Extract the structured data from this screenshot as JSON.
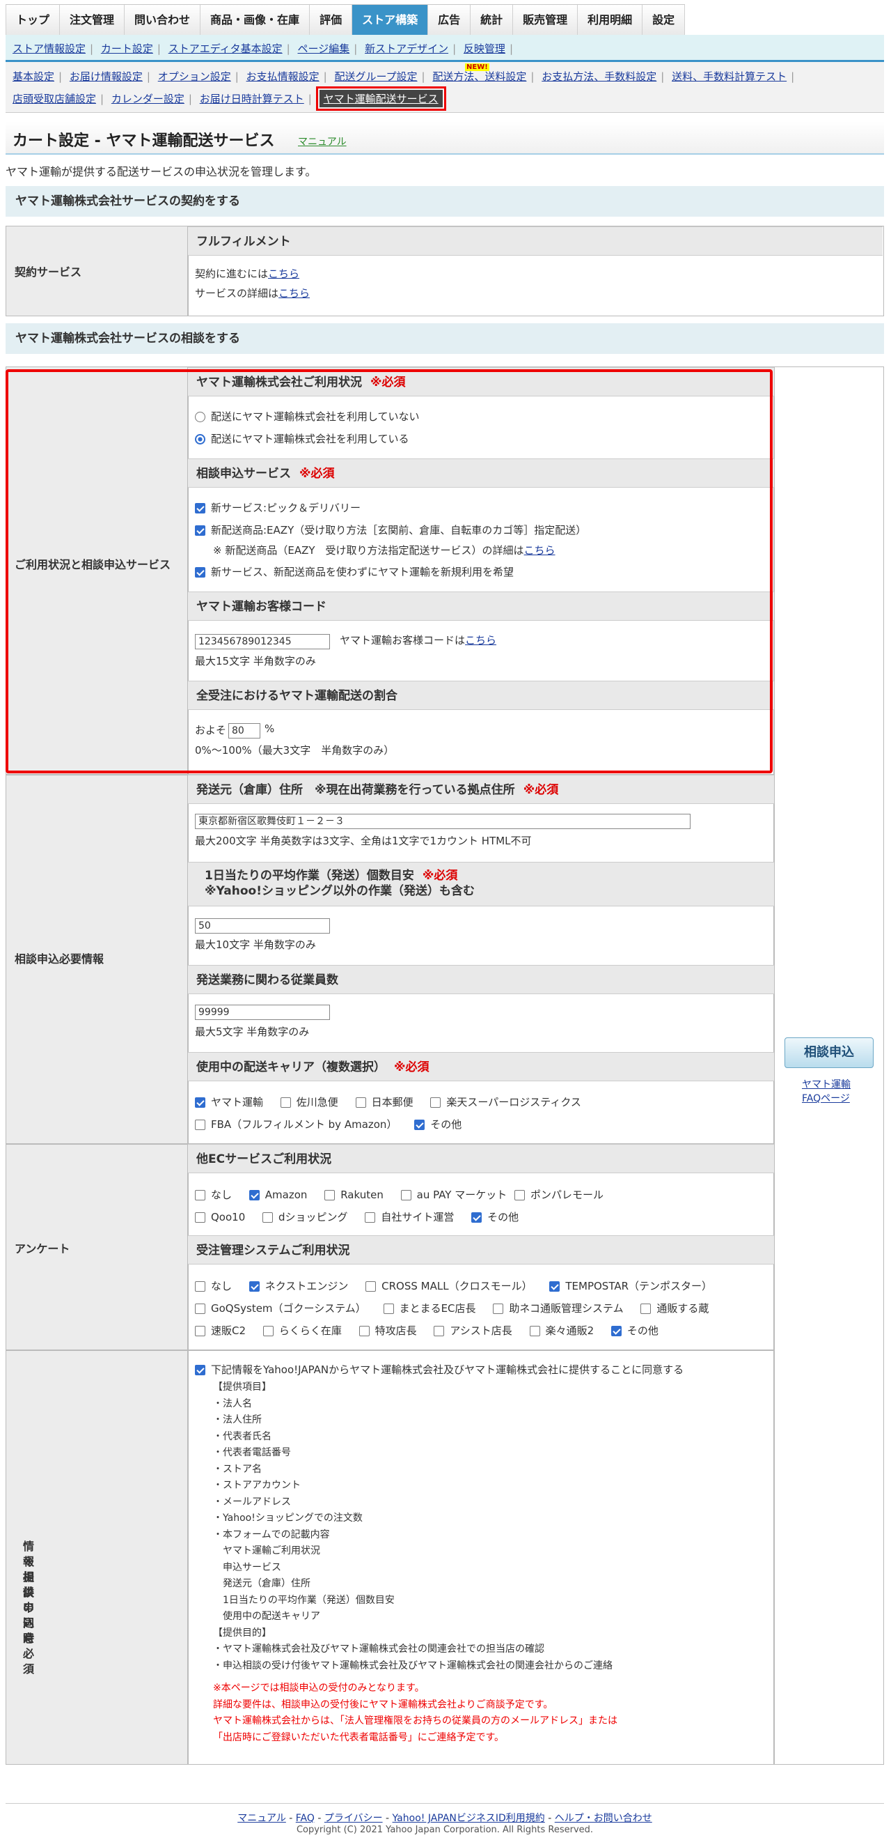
{
  "nav": [
    "トップ",
    "注文管理",
    "問い合わせ",
    "商品・画像・在庫",
    "評価",
    "ストア構築",
    "広告",
    "統計",
    "販売管理",
    "利用明細",
    "設定"
  ],
  "subnav": [
    "ストア情報設定",
    "カート設定",
    "ストアエディタ基本設定",
    "ページ編集",
    "新ストアデザイン",
    "反映管理"
  ],
  "menu_row1": [
    "基本設定",
    "お届け情報設定",
    "オプション設定",
    "お支払情報設定",
    "配送グループ設定",
    "配送方法、送料設定",
    "お支払方法、手数料設定",
    "送料、手数料計算テスト"
  ],
  "menu_row2": [
    "店頭受取店舗設定",
    "カレンダー設定",
    "お届け日時計算テスト"
  ],
  "menu_active": "ヤマト運輸配送サービス",
  "new_badge": "NEW!",
  "page_title": "カート設定 - ヤマト運輸配送サービス",
  "manual_link": "マニュアル",
  "description": "ヤマト運輸が提供する配送サービスの申込状況を管理します。",
  "section1": "ヤマト運輸株式会社サービスの契約をする",
  "contract": {
    "label": "契約サービス",
    "head": "フルフィルメント",
    "line1_pre": "契約に進むには",
    "line2_pre": "サービスの詳細は",
    "link": "こちら"
  },
  "section2": "ヤマト運輸株式会社サービスの相談をする",
  "usage": {
    "label": "ご利用状況と相談申込サービス",
    "status_head": "ヤマト運輸株式会社ご利用状況",
    "req": "※必須",
    "radio1": "配送にヤマト運輸株式会社を利用していない",
    "radio2": "配送にヤマト運輸株式会社を利用している",
    "service_head": "相談申込サービス",
    "svc1": "新サービス:ピック＆デリバリー",
    "svc2": "新配送商品:EAZY（受け取り方法［玄関前、倉庫、自転車のカゴ等］指定配送）",
    "svc2_note": "※ 新配送商品（EAZY　受け取り方法指定配送サービス）の詳細は",
    "svc3": "新サービス、新配送商品を使わずにヤマト運輸を新規利用を希望",
    "code_head": "ヤマト運輸お客様コード",
    "code_value": "123456789012345",
    "code_note": "ヤマト運輸お客様コードは",
    "code_hint": "最大15文字 半角数字のみ",
    "ratio_head": "全受注におけるヤマト運輸配送の割合",
    "ratio_pre": "およそ",
    "ratio_value": "80",
    "ratio_unit": "%",
    "ratio_hint": "0%～100%（最大3文字　半角数字のみ）",
    "link": "こちら"
  },
  "consult": {
    "label": "相談申込必要情報",
    "addr_head": "発送元（倉庫）住所　※現在出荷業務を行っている拠点住所",
    "addr_value": "東京都新宿区歌舞伎町１－２－３",
    "addr_hint": "最大200文字 半角英数字は3文字、全角は1文字で1カウント HTML不可",
    "avg_head1": "1日当たりの平均作業（発送）個数目安",
    "avg_head2": "※Yahoo!ショッピング以外の作業（発送）も含む",
    "avg_value": "50",
    "avg_hint": "最大10文字 半角数字のみ",
    "emp_head": "発送業務に関わる従業員数",
    "emp_value": "99999",
    "emp_hint": "最大5文字 半角数字のみ",
    "carrier_head": "使用中の配送キャリア（複数選択）",
    "carriers_row1": [
      "ヤマト運輸",
      "佐川急便",
      "日本郵便",
      "楽天スーパーロジスティクス"
    ],
    "carriers_row2": [
      "FBA（フルフィルメント by Amazon）",
      "その他"
    ],
    "req": "※必須"
  },
  "apply_button": "相談申込",
  "side_link1": "ヤマト運輸",
  "side_link2": "FAQページ",
  "survey": {
    "label": "アンケート",
    "ec_head": "他ECサービスご利用状況",
    "ec_row1": [
      "なし",
      "Amazon",
      "Rakuten",
      "au PAY マーケット",
      "ポンパレモール"
    ],
    "ec_row2": [
      "Qoo10",
      "dショッピング",
      "自社サイト運営",
      "その他"
    ],
    "sys_head": "受注管理システムご利用状況",
    "sys_row1": [
      "なし",
      "ネクストエンジン",
      "CROSS MALL（クロスモール）",
      "TEMPOSTAR（テンポスター）"
    ],
    "sys_row2": [
      "GoQSystem（ゴクーシステム）",
      "まとまるEC店長",
      "助ネコ通販管理システム",
      "通販する蔵"
    ],
    "sys_row3": [
      "速販C2",
      "らくらく在庫",
      "特攻店長",
      "アシスト店長",
      "楽々通販2",
      "その他"
    ]
  },
  "consent": {
    "label1": "情報提供の同意",
    "label2": "※相談申込時必須",
    "agree": "下記情報をYahoo!JAPANからヤマト運輸株式会社及びヤマト運輸株式会社に提供することに同意する",
    "lines": [
      "【提供項目】",
      "・法人名",
      "・法人住所",
      "・代表者氏名",
      "・代表者電話番号",
      "・ストア名",
      "・ストアアカウント",
      "・メールアドレス",
      "・Yahoo!ショッピングでの注文数",
      "・本フォームでの記載内容",
      "　ヤマト運輸ご利用状況",
      "　申込サービス",
      "　発送元（倉庫）住所",
      "　1日当たりの平均作業（発送）個数目安",
      "　使用中の配送キャリア",
      "【提供目的】",
      "・ヤマト運輸株式会社及びヤマト運輸株式会社の関連会社での担当店の確認",
      "・申込相談の受け付後ヤマト運輸株式会社及びヤマト運輸株式会社の関連会社からのご連絡"
    ],
    "notes": [
      "※本ページでは相談申込の受付のみとなります。",
      "詳細な要件は、相談申込の受付後にヤマト運輸株式会社よりご商談予定です。",
      "ヤマト運輸株式会社からは、「法人管理権限をお持ちの従業員の方のメールアドレス」または",
      "「出店時にご登録いただいた代表者電話番号」にご連絡予定です。"
    ]
  },
  "footer": {
    "links": [
      "マニュアル",
      "FAQ",
      "プライバシー",
      "Yahoo! JAPANビジネスID利用規約",
      "ヘルプ・お問い合わせ"
    ],
    "copyright": "Copyright (C) 2021 Yahoo Japan Corporation. All Rights Reserved."
  }
}
